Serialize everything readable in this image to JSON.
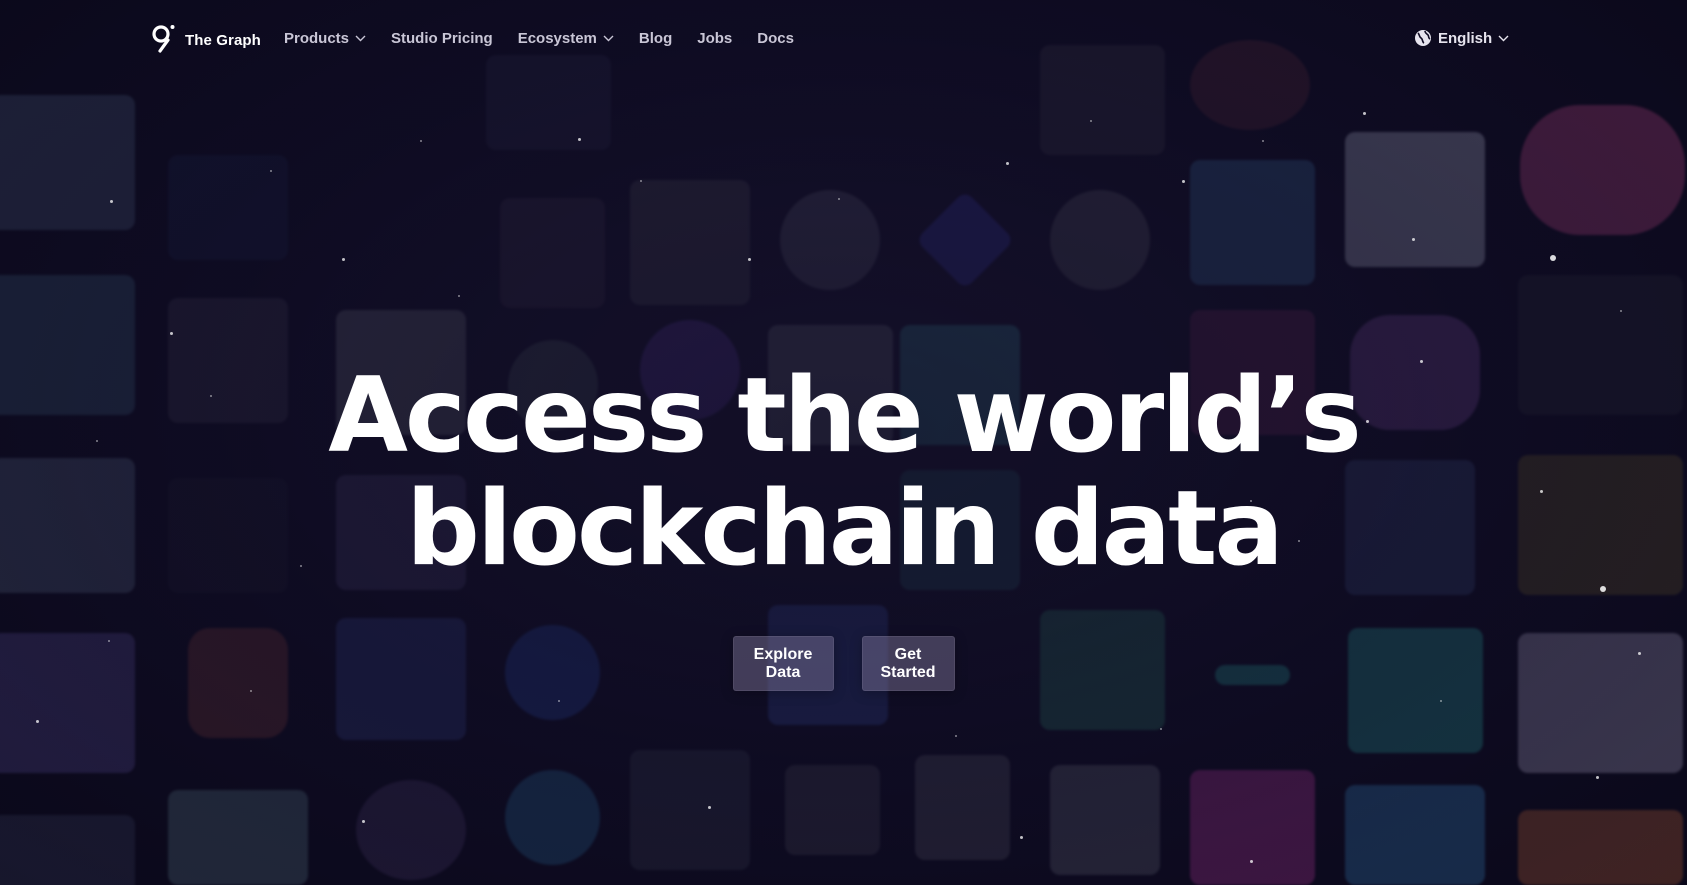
{
  "header": {
    "brand": "The Graph",
    "nav": [
      {
        "label": "Products",
        "dropdown": true
      },
      {
        "label": "Studio Pricing",
        "dropdown": false
      },
      {
        "label": "Ecosystem",
        "dropdown": true
      },
      {
        "label": "Blog",
        "dropdown": false
      },
      {
        "label": "Jobs",
        "dropdown": false
      },
      {
        "label": "Docs",
        "dropdown": false
      }
    ],
    "language": "English"
  },
  "hero": {
    "title_line1": "Access the world’s",
    "title_line2": "blockchain data",
    "primary_button": "Explore Data",
    "secondary_button": "Get Started"
  },
  "colors": {
    "background": "#0c0a1d",
    "nav_text": "#c9c6d6",
    "button_fill": "#968caf",
    "heading_text": "#ffffff"
  },
  "icons": {
    "logo": "the-graph-logo-icon",
    "language": "globe-icon",
    "dropdown": "chevron-down-icon"
  }
}
